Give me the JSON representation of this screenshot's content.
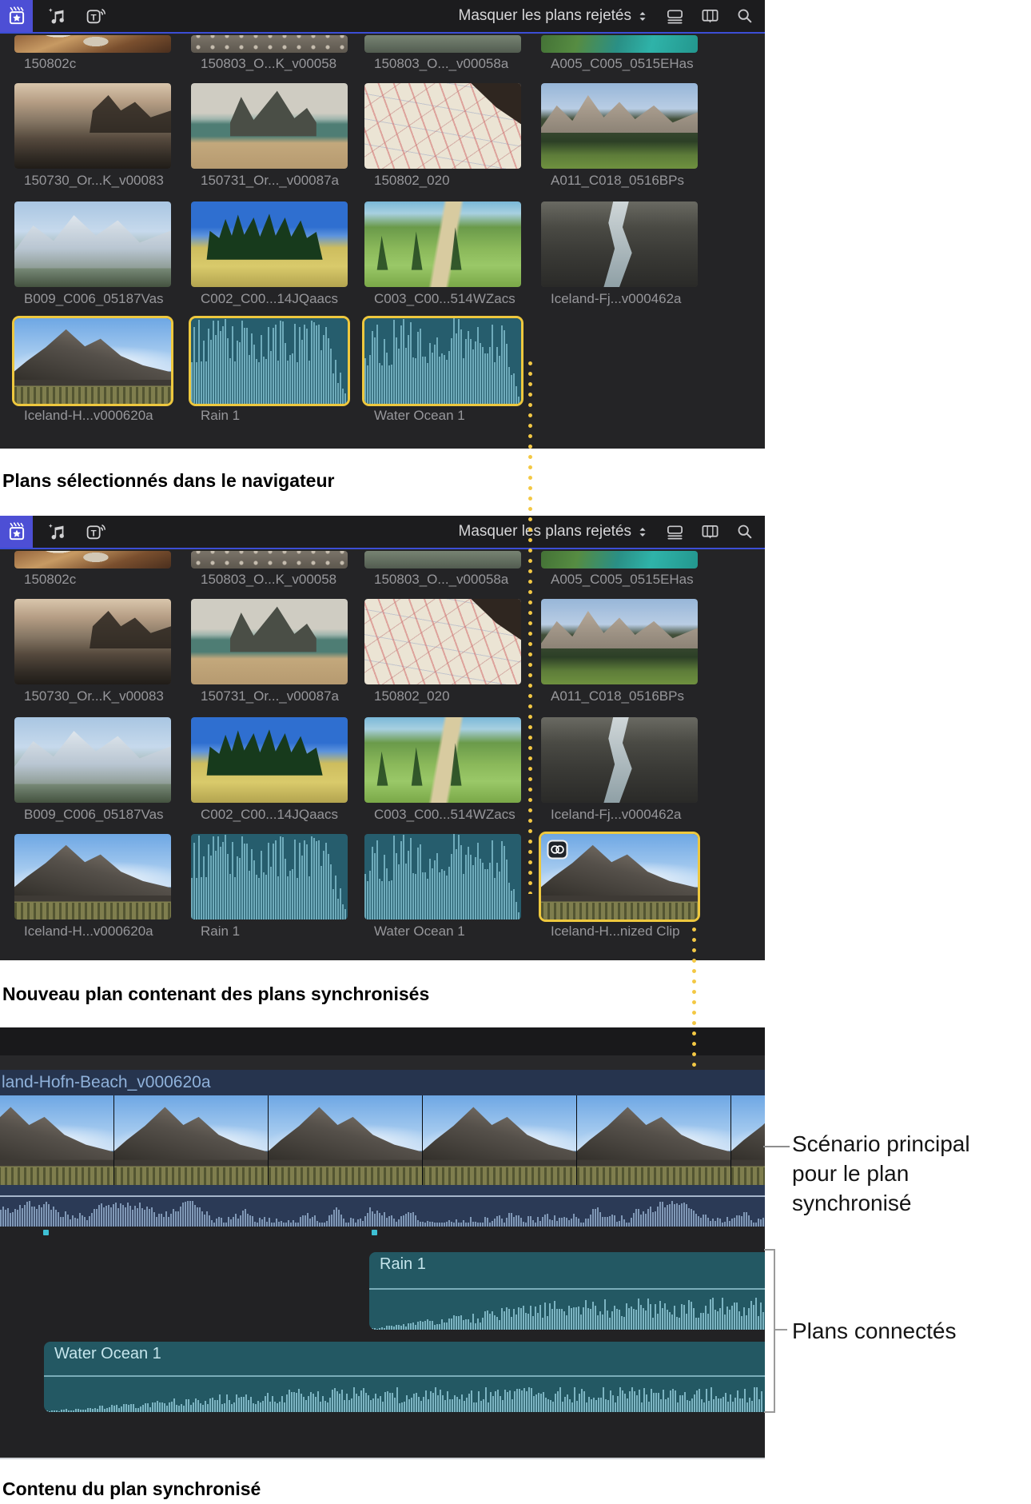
{
  "colors": {
    "selection": "#EEC83E",
    "dotted_line": "#F3C844",
    "toolbar_accent": "#3C4ED6",
    "app_icon": "#4D4FD5"
  },
  "toolbar": {
    "filter_label": "Masquer les plans rejetés",
    "icons_left": [
      "clapper-star-icon",
      "media-music-icon",
      "titles-icon"
    ],
    "icons_right": [
      "clip-appearance-icon",
      "filmstrip-icon",
      "search-icon"
    ]
  },
  "captions": {
    "browser_selected": "Plans sélectionnés dans le navigateur",
    "new_synced_clip": "Nouveau plan contenant des plans synchronisés",
    "synced_clip_contents": "Contenu du plan synchronisé"
  },
  "callouts": {
    "primary_storyline": "Scénario principal pour le plan synchronisé",
    "connected_clips": "Plans connectés"
  },
  "browser1": {
    "rows": [
      [
        {
          "name": "150802c",
          "art": "food"
        },
        {
          "name": "150803_O...K_v00058",
          "art": "pebbles"
        },
        {
          "name": "150803_O..._v00058a",
          "art": "shallow"
        },
        {
          "name": "A005_C005_0515EHas",
          "art": "coast"
        }
      ],
      [
        {
          "name": "150730_Or...K_v00083",
          "art": "rocky"
        },
        {
          "name": "150731_Or..._v00087a",
          "art": "seastacks"
        },
        {
          "name": "150802_020",
          "art": "map"
        },
        {
          "name": "A011_C018_0516BPs",
          "art": "dolomites"
        }
      ],
      [
        {
          "name": "B009_C006_05187Vas",
          "art": "snowy"
        },
        {
          "name": "C002_C00...14JQaacs",
          "art": "cypress"
        },
        {
          "name": "C003_C00...514WZacs",
          "art": "tuscany"
        },
        {
          "name": "Iceland-Fj...v000462a",
          "art": "canyon"
        }
      ],
      [
        {
          "name": "Iceland-H...v000620a",
          "art": "vestrahorn",
          "selected": true
        },
        {
          "name": "Rain 1",
          "art": "wave",
          "selected": true
        },
        {
          "name": "Water Ocean 1",
          "art": "wave",
          "selected": true
        }
      ]
    ]
  },
  "browser2": {
    "rows": [
      [
        {
          "name": "150802c",
          "art": "food"
        },
        {
          "name": "150803_O...K_v00058",
          "art": "pebbles"
        },
        {
          "name": "150803_O..._v00058a",
          "art": "shallow"
        },
        {
          "name": "A005_C005_0515EHas",
          "art": "coast"
        }
      ],
      [
        {
          "name": "150730_Or...K_v00083",
          "art": "rocky"
        },
        {
          "name": "150731_Or..._v00087a",
          "art": "seastacks"
        },
        {
          "name": "150802_020",
          "art": "map"
        },
        {
          "name": "A011_C018_0516BPs",
          "art": "dolomites"
        }
      ],
      [
        {
          "name": "B009_C006_05187Vas",
          "art": "snowy"
        },
        {
          "name": "C002_C00...14JQaacs",
          "art": "cypress"
        },
        {
          "name": "C003_C00...514WZacs",
          "art": "tuscany"
        },
        {
          "name": "Iceland-Fj...v000462a",
          "art": "canyon"
        }
      ],
      [
        {
          "name": "Iceland-H...v000620a",
          "art": "vestrahorn"
        },
        {
          "name": "Rain 1",
          "art": "wave"
        },
        {
          "name": "Water Ocean 1",
          "art": "wave"
        },
        {
          "name": "Iceland-H...nized Clip",
          "art": "vestrahorn",
          "selected": true,
          "badge": true
        }
      ]
    ]
  },
  "timeline": {
    "primary_clip_title": "land-Hofn-Beach_v000620a",
    "connected_clips": [
      {
        "title": "Rain 1"
      },
      {
        "title": "Water Ocean 1"
      }
    ]
  }
}
